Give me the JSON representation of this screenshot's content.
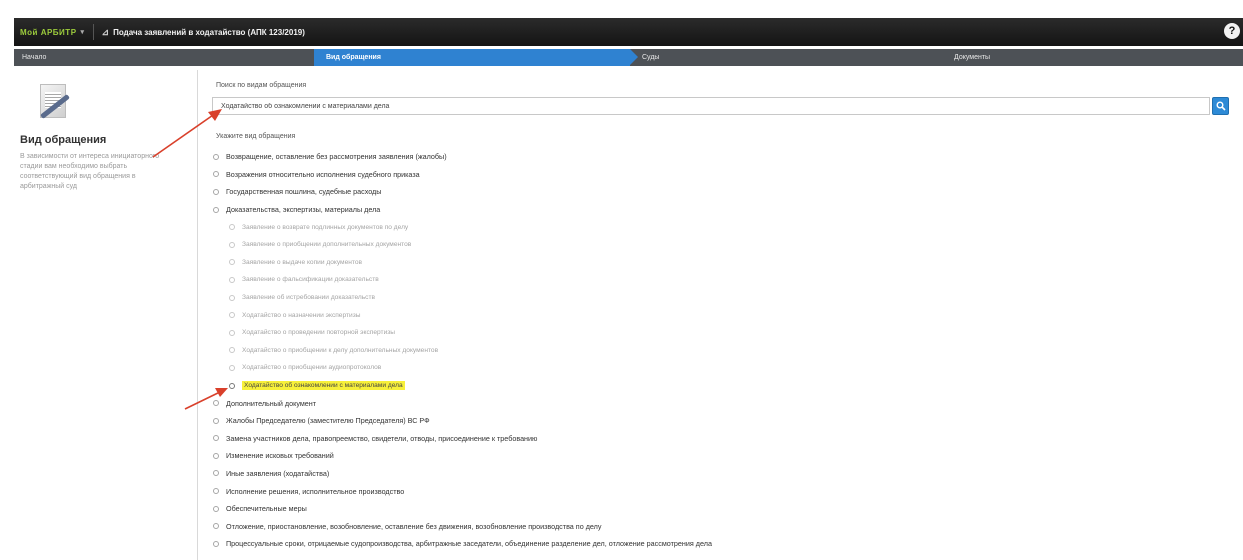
{
  "header": {
    "brand": "Мой АРБИТР",
    "app_title": "Подача заявлений в ходатайство (АПК 123/2019)",
    "help_label": "?"
  },
  "steps": [
    {
      "label": "Начало"
    },
    {
      "label": "Вид обращения"
    },
    {
      "label": "Суды"
    },
    {
      "label": "Документы"
    }
  ],
  "sidebar": {
    "title": "Вид обращения",
    "description": "В зависимости от интереса инициаторного стадии вам необходимо выбрать соответствующий вид обращения в арбитражный суд"
  },
  "search": {
    "label": "Поиск по видам обращения",
    "value": "Ходатайство об ознакомлении с материалами дела",
    "button_icon": "search-icon"
  },
  "type_list_label": "Укажите вид обращения",
  "types": [
    {
      "label": "Возвращение, оставление без рассмотрения заявления (жалобы)"
    },
    {
      "label": "Возражения относительно исполнения судебного приказа"
    },
    {
      "label": "Государственная пошлина, судебные расходы"
    },
    {
      "label": "Доказательства, экспертизы, материалы дела"
    },
    {
      "label": "Заявление о возврате подлинных документов по делу",
      "child": true
    },
    {
      "label": "Заявление о приобщении дополнительных документов",
      "child": true
    },
    {
      "label": "Заявление о выдаче копии документов",
      "child": true
    },
    {
      "label": "Заявление о фальсификации доказательств",
      "child": true
    },
    {
      "label": "Заявление об истребовании доказательств",
      "child": true
    },
    {
      "label": "Ходатайство о назначении экспертизы",
      "child": true
    },
    {
      "label": "Ходатайство о проведении повторной экспертизы",
      "child": true
    },
    {
      "label": "Ходатайство о приобщении к делу дополнительных документов",
      "child": true
    },
    {
      "label": "Ходатайство о приобщении аудиопротоколов",
      "child": true
    },
    {
      "label": "Ходатайство об ознакомлении с материалами дела",
      "child": true,
      "selected": true
    },
    {
      "label": "Дополнительный документ"
    },
    {
      "label": "Жалобы Председателю (заместителю Председателя) ВС РФ"
    },
    {
      "label": "Замена участников дела, правопреемство, свидетели, отводы, присоединение к требованию"
    },
    {
      "label": "Изменение исковых требований"
    },
    {
      "label": "Иные заявления (ходатайства)"
    },
    {
      "label": "Исполнение решения, исполнительное производство"
    },
    {
      "label": "Обеспечительные меры"
    },
    {
      "label": "Отложение, приостановление, возобновление, оставление без движения, возобновление производства по делу"
    },
    {
      "label": "Процессуальные сроки, отрицаемые судопроизводства, арбитражные заседатели, объединение разделение дел, отложение рассмотрения дела"
    }
  ],
  "colors": {
    "active_step": "#2f82d1",
    "highlight": "#f7f03a",
    "annotation_arrow": "#d9402b"
  }
}
